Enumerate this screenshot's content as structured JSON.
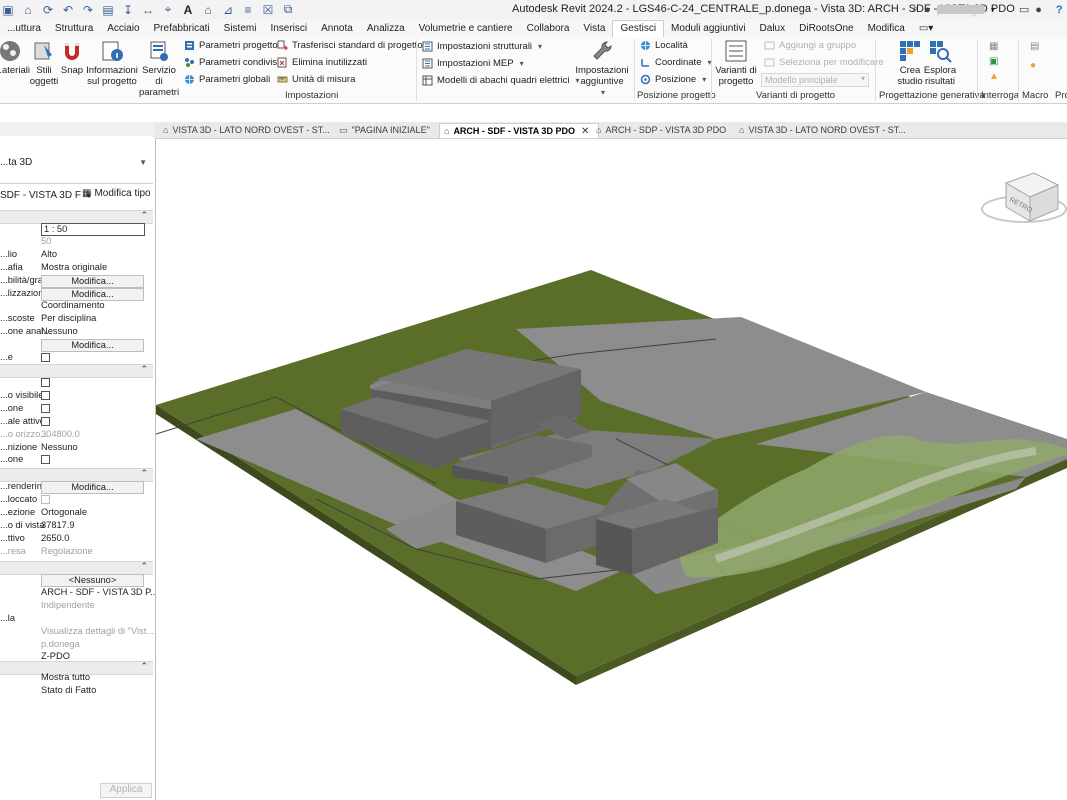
{
  "app": {
    "title": "Autodesk Revit 2024.2 - LGS46-C-24_CENTRALE_p.donega - Vista 3D: ARCH - SDF - VISTA 3D PDO",
    "user_name": "p.donega"
  },
  "ribbon_tabs": [
    "...uttura",
    "Struttura",
    "Acciaio",
    "Prefabbricati",
    "Sistemi",
    "Inserisci",
    "Annota",
    "Analizza",
    "Volumetrie e cantiere",
    "Collabora",
    "Vista",
    "Gestisci",
    "Moduli aggiuntivi",
    "Dalux",
    "DiRootsOne",
    "Modifica"
  ],
  "active_tab": "Gestisci",
  "ribbon": {
    "materials": "...ateriali",
    "object_styles": "Stili oggetti",
    "snap": "Snap",
    "project_info": "Informazioni sul progetto",
    "parameter_service": "Servizio di parametri",
    "project_params": "Parametri progetto",
    "shared_params": "Parametri condivisi",
    "global_params": "Parametri  globali",
    "transfer_standards": "Trasferisci standard di progetto",
    "purge_unused": "Elimina inutilizzati",
    "units": "Unità di misura",
    "structural_settings": "Impostazioni strutturali",
    "mep_settings": "Impostazioni MEP",
    "panel_schedule_templates": "Modelli di abachi quadri elettrici",
    "additional_settings": "Impostazioni aggiuntive",
    "settings_panel": "Impostazioni",
    "location": "Località",
    "coordinates": "Coordinate",
    "position": "Posizione",
    "project_location_panel": "Posizione progetto",
    "design_options": "Varianti di progetto",
    "add_to_set": "Aggiungi a gruppo",
    "pick_to_edit": "Seleziona per modificare",
    "main_model": "Modello principale",
    "design_options_panel": "Varianti di progetto",
    "create_study": "Crea studio",
    "explore_results": "Esplora risultati",
    "generative_design_panel": "Progettazione generativa",
    "inquiry_panel": "Interroga",
    "macro_panel": "Macro",
    "pro_panel": "Pro"
  },
  "properties": {
    "type_value": "...ta 3D",
    "instance_selector": "SDF - VISTA 3D F",
    "edit_type": "Modifica tipo",
    "rows_graphics": [
      {
        "label": "",
        "value": "1 : 50",
        "kind": "box"
      },
      {
        "label": "",
        "value": "50",
        "kind": "gray"
      },
      {
        "label": "...lio",
        "value": "Alto",
        "kind": "text"
      },
      {
        "label": "...afia",
        "value": "Mostra originale",
        "kind": "text"
      },
      {
        "label": "...bilità/gra...",
        "value": "Modifica...",
        "kind": "btn"
      },
      {
        "label": "...lizzazion...",
        "value": "Modifica...",
        "kind": "btn"
      },
      {
        "label": "",
        "value": "Coordinamento",
        "kind": "text"
      },
      {
        "label": "...scoste",
        "value": "Per disciplina",
        "kind": "text"
      },
      {
        "label": "...one anal...",
        "value": "Nessuno",
        "kind": "text"
      },
      {
        "label": "",
        "value": "Modifica...",
        "kind": "btn"
      },
      {
        "label": "...e",
        "value": "",
        "kind": "cb"
      }
    ],
    "rows_extents": [
      {
        "label": "",
        "value": "",
        "kind": "cb"
      },
      {
        "label": "...o visibile",
        "value": "",
        "kind": "cb"
      },
      {
        "label": "...one",
        "value": "",
        "kind": "cb"
      },
      {
        "label": "...ale attivo",
        "value": "",
        "kind": "cb"
      },
      {
        "label": "...o orizzo...",
        "value": "304800.0",
        "kind": "gray"
      },
      {
        "label": "...nizione",
        "value": "Nessuno",
        "kind": "text"
      },
      {
        "label": "...one",
        "value": "",
        "kind": "cb"
      }
    ],
    "rows_camera": [
      {
        "label": "...rendering",
        "value": "Modifica...",
        "kind": "btn"
      },
      {
        "label": "...loccato",
        "value": "",
        "kind": "cbgray"
      },
      {
        "label": "...ezione",
        "value": "Ortogonale",
        "kind": "text"
      },
      {
        "label": "...o di vista",
        "value": "37817.9",
        "kind": "text"
      },
      {
        "label": "...ttivo",
        "value": "2650.0",
        "kind": "text"
      },
      {
        "label": "...resa",
        "value": "Regolazione",
        "kind": "gray"
      }
    ],
    "rows_identity": [
      {
        "label": "",
        "value": "<Nessuno>",
        "kind": "btn"
      },
      {
        "label": "",
        "value": "ARCH - SDF - VISTA 3D P...",
        "kind": "text"
      },
      {
        "label": "",
        "value": "Indipendente",
        "kind": "gray"
      },
      {
        "label": "...la",
        "value": "",
        "kind": "text"
      },
      {
        "label": "",
        "value": "Visualizza dettagli di \"Vist...",
        "kind": "gray"
      },
      {
        "label": "",
        "value": "p.donega",
        "kind": "gray"
      },
      {
        "label": "",
        "value": "Z-PDO",
        "kind": "text"
      }
    ],
    "rows_phasing": [
      {
        "label": "",
        "value": "Mostra tutto",
        "kind": "text"
      },
      {
        "label": "",
        "value": "Stato di Fatto",
        "kind": "text"
      }
    ],
    "apply": "Applica"
  },
  "view_tabs": [
    {
      "label": "VISTA 3D - LATO NORD OVEST - ST...",
      "icon": "3d-view-icon",
      "active": false
    },
    {
      "label": "\"PAGINA INIZIALE\"",
      "icon": "sheet-icon",
      "active": false
    },
    {
      "label": "ARCH - SDF - VISTA 3D PDO",
      "icon": "3d-view-icon",
      "active": true
    },
    {
      "label": "ARCH - SDP - VISTA 3D PDO",
      "icon": "3d-view-icon",
      "active": false
    },
    {
      "label": "VISTA 3D - LATO NORD OVEST - ST...",
      "icon": "3d-view-icon",
      "active": false
    }
  ],
  "viewcube_label": "RETRO",
  "colors": {
    "terrain_green": "#5a6e2a",
    "road_gray": "#8d8d8d",
    "building": "#6f6f6f",
    "ribbon_accent": "#2f6fb5"
  }
}
